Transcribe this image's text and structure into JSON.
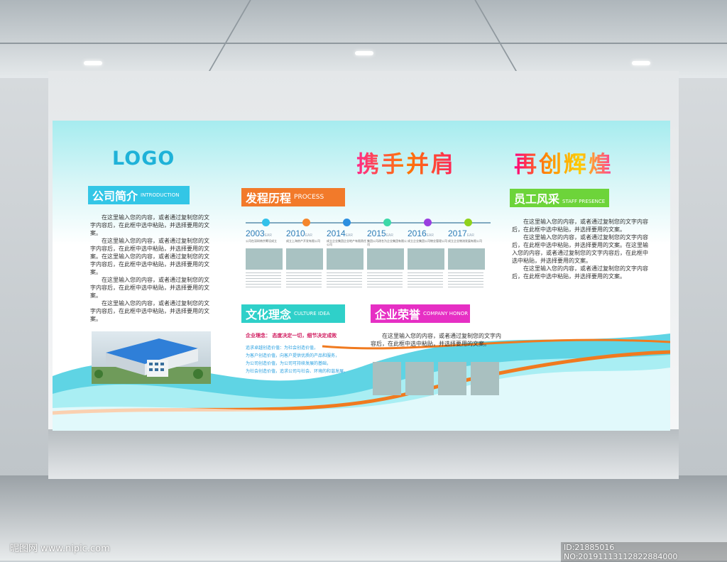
{
  "board": {
    "logo": "LOGO",
    "slogan_left": "携手并肩",
    "slogan_right": "再创辉煌"
  },
  "sections": {
    "intro": {
      "title": "公司简介",
      "subtitle": "INTRODUCTION",
      "color": "#33c6e6",
      "paragraphs": [
        "在这里输入您的内容，或者通过复制您的文字内容后，在此框中选中粘贴，并选择要用的文案。",
        "在这里输入您的内容，或者通过复制您的文字内容后，在此框中选中粘贴，并选择要用的文案。在这里输入您的内容，或者通过复制您的文字内容后，在此框中选中粘贴，并选择要用的文案。",
        "在这里输入您的内容，或者通过复制您的文字内容后，在此框中选中粘贴，并选择要用的文案。",
        "在这里输入您的内容，或者通过复制您的文字内容后，在此框中选中粘贴，并选择要用的文案。"
      ]
    },
    "process": {
      "title": "发程历程",
      "subtitle": "PROCESS",
      "color": "#f27a2a",
      "year_suffix": "EAR",
      "items": [
        {
          "year": "2003",
          "desc": "公司在深圳南京筹设成立",
          "dot": "#33c1ea"
        },
        {
          "year": "2010",
          "desc": "成立上海房产开发有限公司",
          "dot": "#f5862c"
        },
        {
          "year": "2014",
          "desc": "成立企业集团企业地产有限责任公司",
          "dot": "#2d8fe0"
        },
        {
          "year": "2015",
          "desc": "集团公司改名为企业集团有限公司",
          "dot": "#3dd9a8"
        },
        {
          "year": "2016",
          "desc": "成立企业集团公司物业管理公司",
          "dot": "#9a3fe0"
        },
        {
          "year": "2017",
          "desc": "成立企业物流发展有限公司",
          "dot": "#8fd21c"
        }
      ]
    },
    "culture": {
      "title": "文化理念",
      "subtitle": "CULTURE IDEA",
      "color": "#2fd0c9",
      "lead": "企业理念：  态度决定一切，细节决定成败",
      "lines": [
        "追求卓越创造价值：为社会创造价值，",
        "为客户创造价值，向客户提供优质的产品和服务，",
        "为公司创造价值，为公司可持续发展的基础，",
        "为社会创造价值，追求公司与社会、环境的和谐发展。"
      ]
    },
    "honor": {
      "title": "企业荣誉",
      "subtitle": "COMPANY HONOR",
      "color": "#e62fc4",
      "paragraph": "在这里输入您的内容，或者通过复制您的文字内容后，在此框中选中粘贴，并选择要用的文案。"
    },
    "staff": {
      "title": "员工风采",
      "subtitle": "STAFF PRESENCE",
      "color": "#6dd43a",
      "paragraphs": [
        "在这里输入您的内容，或者通过复制您的文字内容后，在此框中选中粘贴，并选择要用的文案。",
        "在这里输入您的内容，或者通过复制您的文字内容后，在此框中选中粘贴，并选择要用的文案。在这里输入您的内容，或者通过复制您的文字内容后，在此框中选中粘贴，并选择要用的文案。",
        "在这里输入您的内容，或者通过复制您的文字内容后，在此框中选中粘贴，并选择要用的文案。"
      ]
    }
  },
  "watermark": {
    "site": "昵图网 www.nipic.com",
    "id": "ID:21885016 NO:20191113112822884000"
  }
}
